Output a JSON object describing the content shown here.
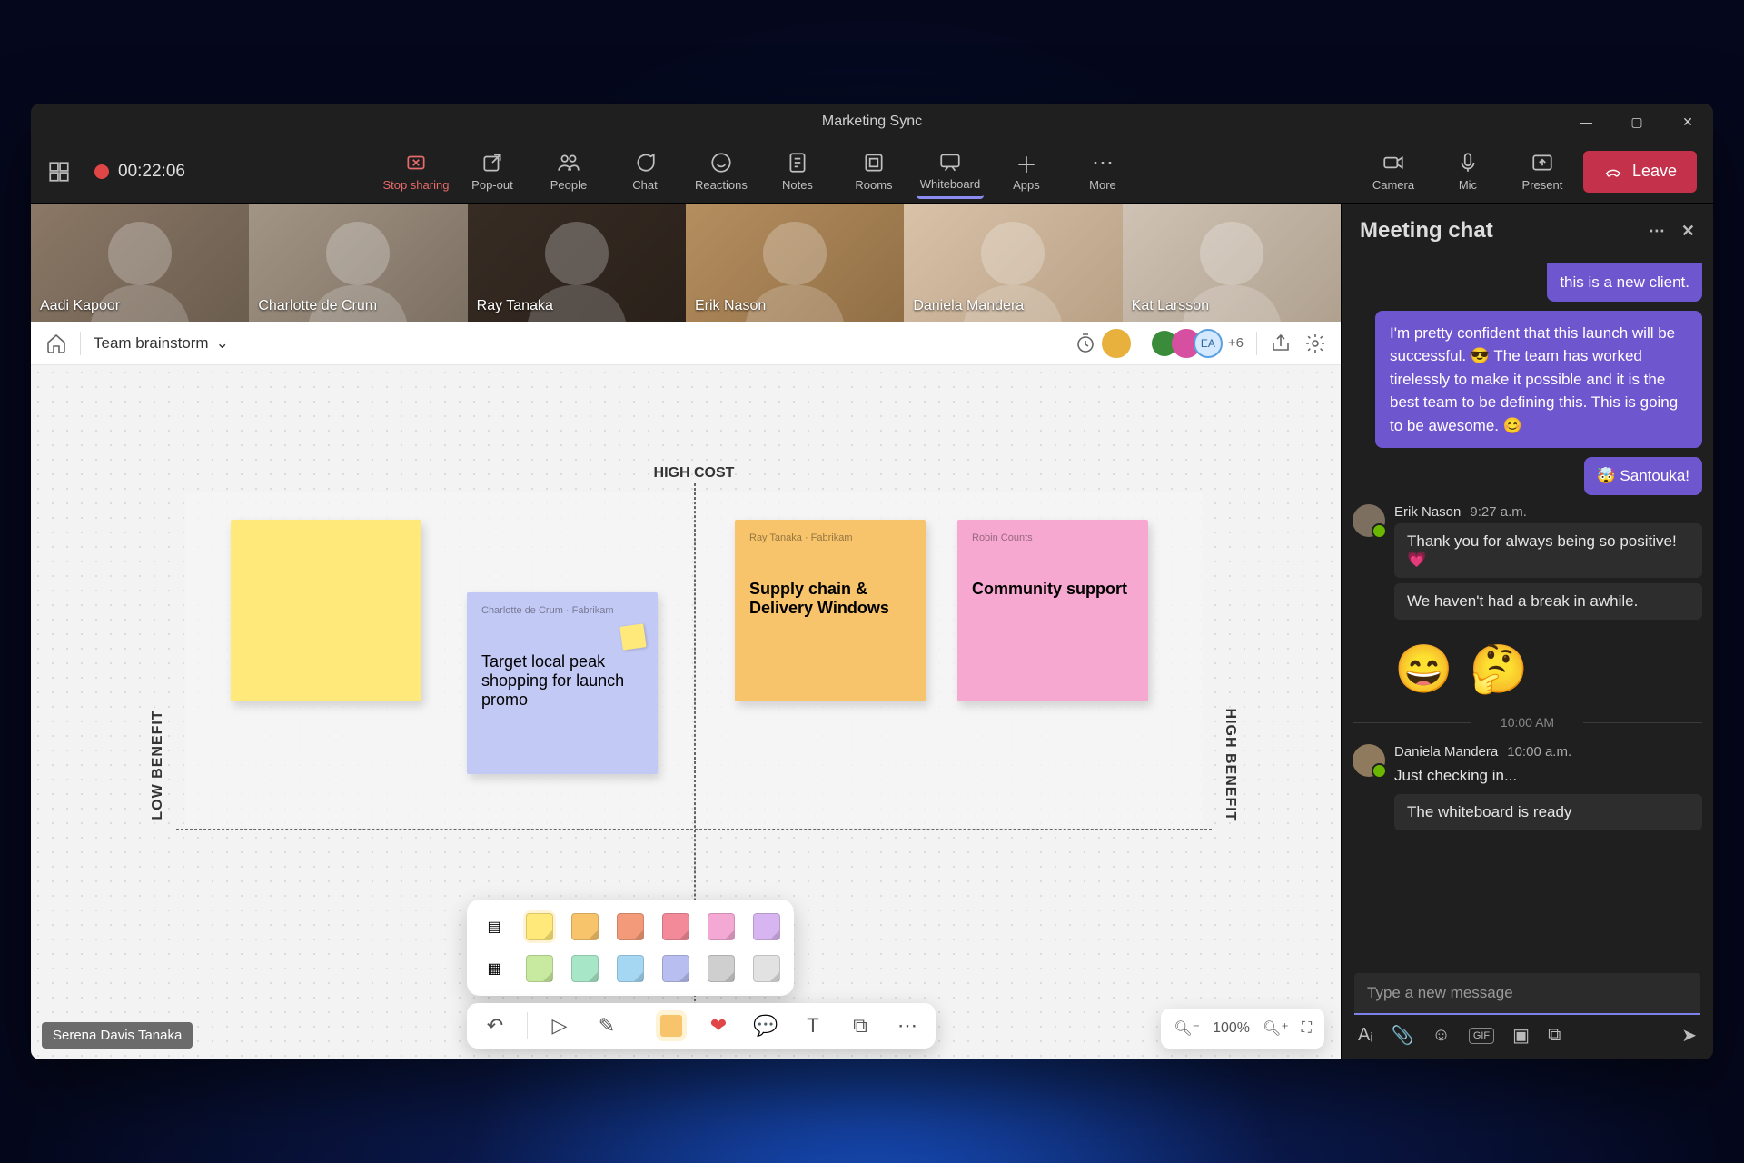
{
  "window": {
    "title": "Marketing Sync"
  },
  "recording": {
    "time": "00:22:06"
  },
  "toolbar": {
    "stop_sharing": "Stop sharing",
    "popout": "Pop-out",
    "people": "People",
    "chat": "Chat",
    "reactions": "Reactions",
    "notes": "Notes",
    "rooms": "Rooms",
    "whiteboard": "Whiteboard",
    "apps": "Apps",
    "more": "More",
    "camera": "Camera",
    "mic": "Mic",
    "present": "Present",
    "leave": "Leave"
  },
  "participants": [
    {
      "name": "Aadi Kapoor"
    },
    {
      "name": "Charlotte de Crum"
    },
    {
      "name": "Ray Tanaka"
    },
    {
      "name": "Erik Nason"
    },
    {
      "name": "Daniela Mandera"
    },
    {
      "name": "Kat Larsson"
    }
  ],
  "whiteboard": {
    "title": "Team brainstorm",
    "extra_avatars": "+6",
    "axes": {
      "top": "HIGH COST",
      "left": "LOW BENEFIT",
      "right": "HIGH BENEFIT"
    },
    "stickies": {
      "s1_author": "",
      "s2_author": "Charlotte de Crum · Fabrikam",
      "s2_text": "Target local peak shopping for launch promo",
      "s3_author": "Ray Tanaka · Fabrikam",
      "s3_text": "Supply chain & Delivery Windows",
      "s4_author": "Robin Counts",
      "s4_text": "Community support"
    },
    "user_tag": "Serena Davis Tanaka",
    "zoom": "100%"
  },
  "chat": {
    "title": "Meeting chat",
    "m0": "this is a new client.",
    "m1": "I'm pretty confident that this launch will be successful. 😎 The team has worked tirelessly to make it possible and it is the best team to be defining this. This is going to be awesome. 😊",
    "m2": "🤯 Santouka!",
    "erik": {
      "name": "Erik Nason",
      "time": "9:27 a.m.",
      "line1": "Thank you for always being so positive! 💗",
      "line2": "We haven't had a break in awhile."
    },
    "divider_time": "10:00 AM",
    "daniela": {
      "name": "Daniela Mandera",
      "time": "10:00 a.m.",
      "line1": "Just checking in...",
      "line2": "The whiteboard is ready"
    },
    "compose_placeholder": "Type a new message"
  }
}
